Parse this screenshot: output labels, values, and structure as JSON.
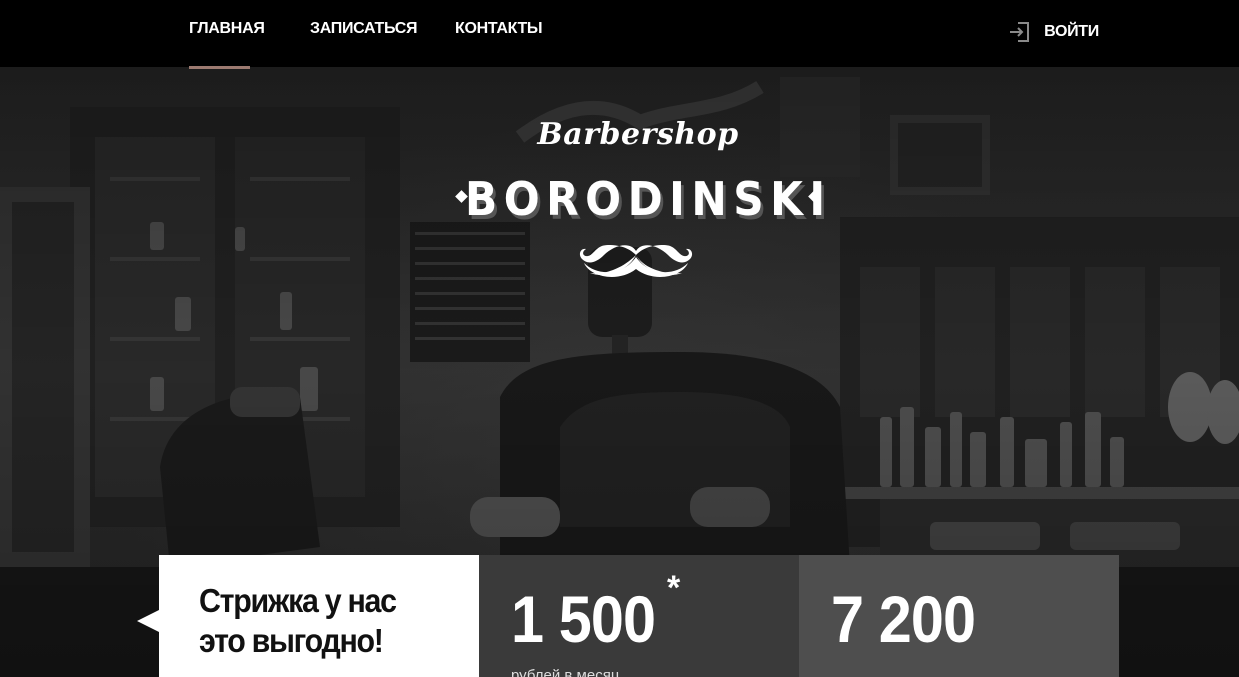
{
  "nav": {
    "items": [
      {
        "label": "ГЛАВНАЯ",
        "active": true
      },
      {
        "label": "ЗАПИСАТЬСЯ",
        "active": false
      },
      {
        "label": "КОНТАКТЫ",
        "active": false
      }
    ],
    "login_label": "ВОЙТИ",
    "login_icon": "login-icon",
    "accent_color": "#9c7a70"
  },
  "logo": {
    "script": "Barbershop",
    "name": "BORODINSKI",
    "emblem_icon": "mustache-icon"
  },
  "promo": {
    "title_line1": "Стрижка у нас",
    "title_line2": "это выгодно!"
  },
  "prices": [
    {
      "value": "1 500",
      "mark": "*",
      "caption": "рублей в месяц",
      "background": "#3a3a3a"
    },
    {
      "value": "7 200",
      "mark": "",
      "caption": "",
      "background": "#4e4e4e"
    }
  ]
}
